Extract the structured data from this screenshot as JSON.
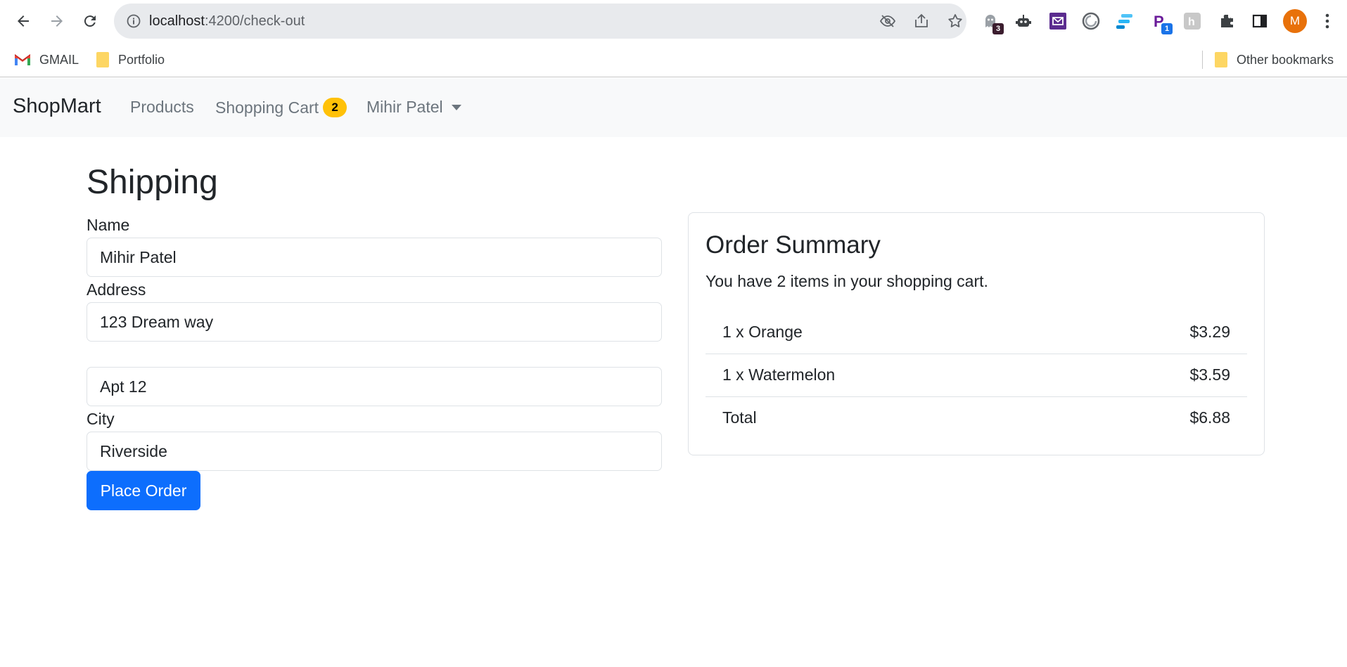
{
  "browser": {
    "url_host": "localhost",
    "url_path": ":4200/check-out",
    "extensions": [
      {
        "name": "ghost-extension-icon",
        "badge": "3",
        "badge_color": "#3b1d2e"
      },
      {
        "name": "robot-extension-icon",
        "badge": ""
      },
      {
        "name": "mailbox-extension-icon",
        "badge": ""
      },
      {
        "name": "swirl-extension-icon",
        "badge": ""
      },
      {
        "name": "stack-extension-icon",
        "badge": ""
      },
      {
        "name": "p-extension-icon",
        "badge": "1",
        "badge_color": "#1a73e8"
      },
      {
        "name": "h-extension-icon",
        "badge": ""
      }
    ],
    "avatar_letter": "M",
    "avatar_color": "#e8710a"
  },
  "bookmarks": {
    "items": [
      {
        "label": "GMAIL"
      },
      {
        "label": "Portfolio"
      }
    ],
    "other": "Other bookmarks"
  },
  "navbar": {
    "brand": "ShopMart",
    "products": "Products",
    "cart": "Shopping Cart",
    "cart_count": "2",
    "user": "Mihir Patel"
  },
  "shipping": {
    "title": "Shipping",
    "name_label": "Name",
    "name_value": "Mihir Patel",
    "address_label": "Address",
    "address1_value": "123 Dream way",
    "address2_value": "Apt 12",
    "city_label": "City",
    "city_value": "Riverside",
    "submit": "Place Order"
  },
  "summary": {
    "title": "Order Summary",
    "text": "You have 2 items in your shopping cart.",
    "items": [
      {
        "name": "1 x Orange",
        "price": "$3.29"
      },
      {
        "name": "1 x Watermelon",
        "price": "$3.59"
      }
    ],
    "total_label": "Total",
    "total_value": "$6.88"
  },
  "colors": {
    "primary": "#0d6efd",
    "badge": "#ffc107",
    "navbar_bg": "#f8f9fa"
  }
}
